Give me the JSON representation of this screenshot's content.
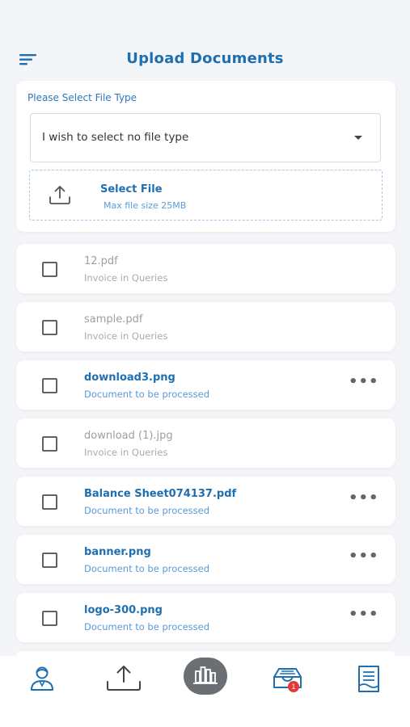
{
  "header": {
    "title": "Upload Documents",
    "menu_icon": "menu-icon"
  },
  "upload": {
    "label": "Please Select File Type",
    "select_value": "I wish to select no file type",
    "drop_title": "Select File",
    "drop_sub": "Max file size 25MB"
  },
  "files": [
    {
      "name": "12.pdf",
      "status": "Invoice in Queries",
      "state": "grey",
      "checked": false,
      "has_more": false
    },
    {
      "name": "sample.pdf",
      "status": "Invoice in Queries",
      "state": "grey",
      "checked": false,
      "has_more": false
    },
    {
      "name": "download3.png",
      "status": "Document to be processed",
      "state": "active",
      "checked": false,
      "has_more": true
    },
    {
      "name": "download (1).jpg",
      "status": "Invoice in Queries",
      "state": "grey",
      "checked": false,
      "has_more": false
    },
    {
      "name": "Balance Sheet074137.pdf",
      "status": "Document to be processed",
      "state": "active",
      "checked": false,
      "has_more": true
    },
    {
      "name": "banner.png",
      "status": "Document to be processed",
      "state": "active",
      "checked": false,
      "has_more": true
    },
    {
      "name": "logo-300.png",
      "status": "Document to be processed",
      "state": "active",
      "checked": false,
      "has_more": true
    }
  ],
  "nav": {
    "items": [
      "profile-icon",
      "upload-icon",
      "chart-icon",
      "inbox-icon",
      "documents-icon"
    ],
    "inbox_badge": "1"
  },
  "colors": {
    "primary": "#1d6fb2",
    "accent": "#5b9bd5",
    "muted": "#9aa0a6",
    "badge": "#e53935"
  }
}
